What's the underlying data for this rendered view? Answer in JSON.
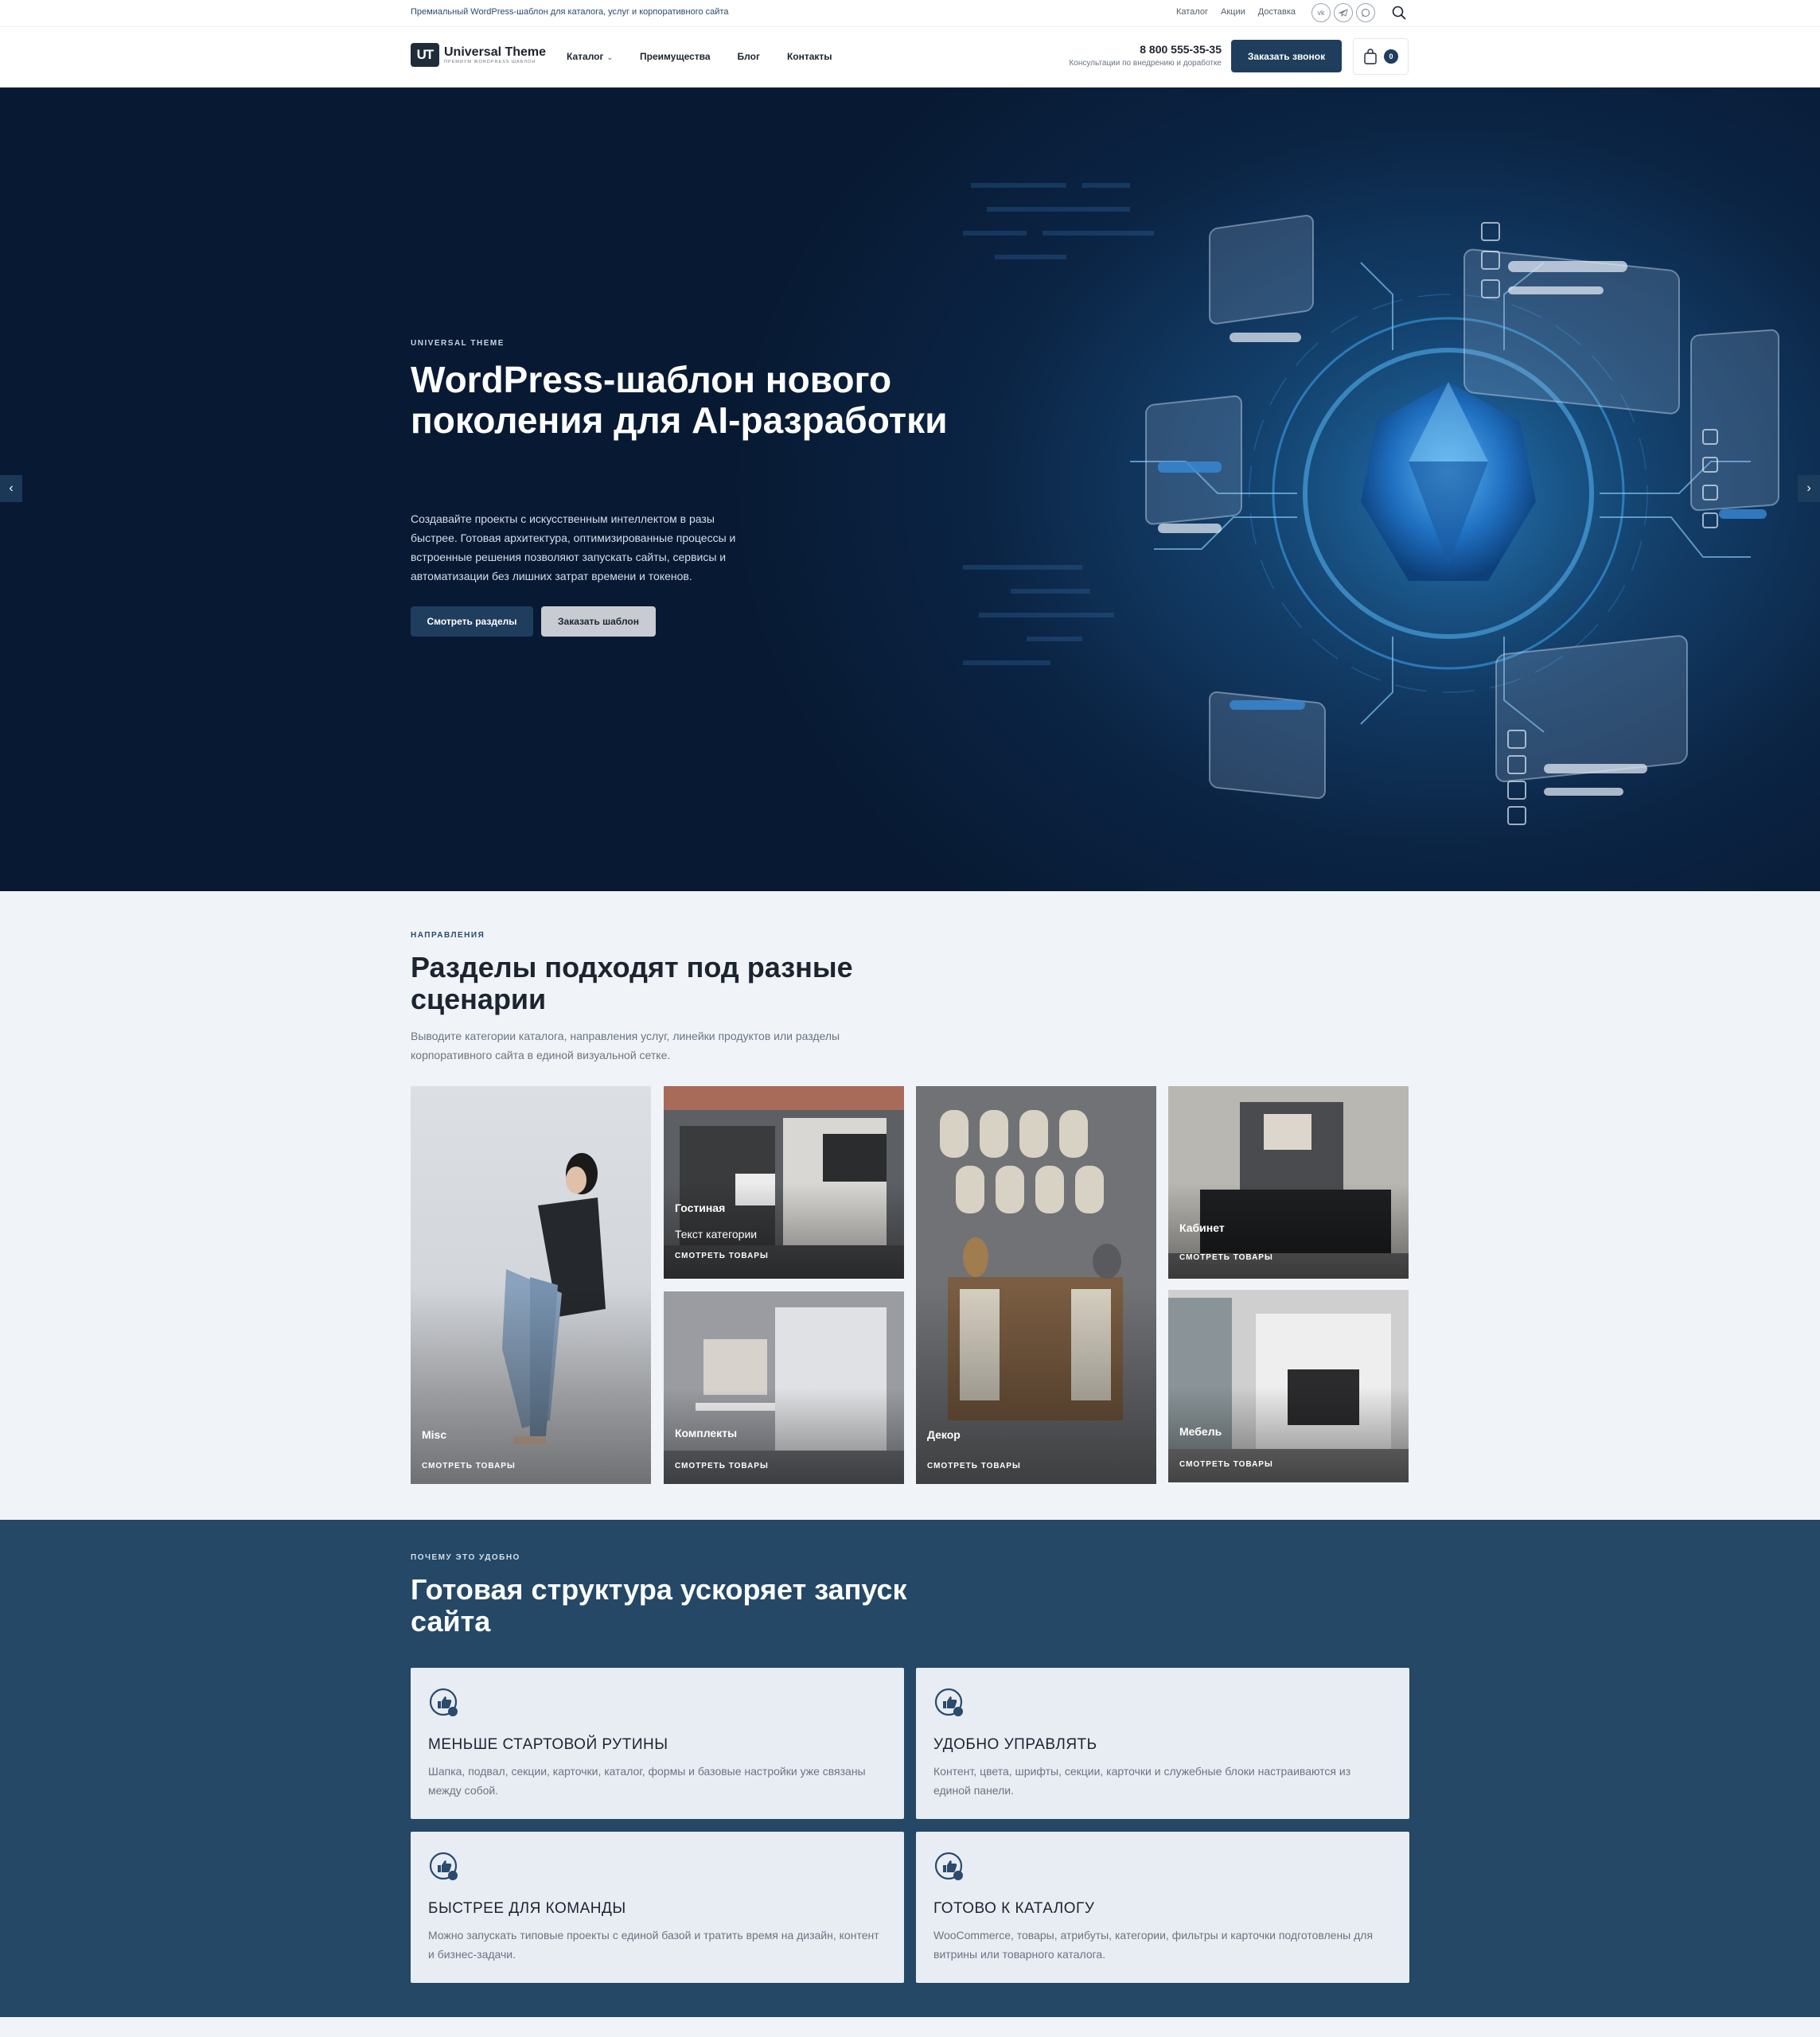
{
  "topbar": {
    "tagline": "Премиальный WordPress-шаблон для каталога, услуг и корпоративного сайта",
    "links": [
      "Каталог",
      "Акции",
      "Доставка"
    ],
    "socials": [
      "vk-icon",
      "telegram-icon",
      "whatsapp-icon"
    ]
  },
  "header": {
    "logo_mark": "UT",
    "logo_title": "Universal Theme",
    "logo_subtitle": "Премиум WordPress шаблон",
    "nav": [
      "Каталог",
      "Преимущества",
      "Блог",
      "Контакты"
    ],
    "phone": "8 800 555-35-35",
    "phone_sub": "Консультации по внедрению и доработке",
    "call_button": "Заказать звонок",
    "cart_count": "0"
  },
  "hero": {
    "eyebrow": "UNIVERSAL THEME",
    "title": "WordPress-шаблон нового поколения для AI-разработки",
    "description": "Создавайте проекты с искусственным интеллектом в разы быстрее. Готовая архитектура, оптимизированные процессы и встроенные решения позволяют запускать сайты, сервисы и автоматизации без лишних затрат времени и токенов.",
    "primary_button": "Смотреть разделы",
    "secondary_button": "Заказать шаблон",
    "colors": {
      "accent": "#1f3e5e",
      "hero_bg": "#0b2444"
    }
  },
  "sections": {
    "eyebrow": "НАПРАВЛЕНИЯ",
    "title": "Разделы подходят под разные сценарии",
    "description": "Выводите категории каталога, направления услуг, линейки продуктов или разделы корпоративного сайта в единой визуальной сетке.",
    "cards": [
      {
        "title": "Misc",
        "link": "СМОТРЕТЬ ТОВАРЫ"
      },
      {
        "title": "Гостиная",
        "text": "Текст категории",
        "link": "СМОТРЕТЬ ТОВАРЫ"
      },
      {
        "title": "Комплекты",
        "link": "СМОТРЕТЬ ТОВАРЫ"
      },
      {
        "title": "Декор",
        "link": "СМОТРЕТЬ ТОВАРЫ"
      },
      {
        "title": "Кабинет",
        "link": "СМОТРЕТЬ ТОВАРЫ"
      },
      {
        "title": "Мебель",
        "link": "СМОТРЕТЬ ТОВАРЫ"
      }
    ]
  },
  "features": {
    "eyebrow": "ПОЧЕМУ ЭТО УДОБНО",
    "title": "Готовая структура ускоряет запуск сайта",
    "items": [
      {
        "title": "МЕНЬШЕ СТАРТОВОЙ РУТИНЫ",
        "description": "Шапка, подвал, секции, карточки, каталог, формы и базовые настройки уже связаны между собой."
      },
      {
        "title": "УДОБНО УПРАВЛЯТЬ",
        "description": "Контент, цвета, шрифты, секции, карточки и служебные блоки настраиваются из единой панели."
      },
      {
        "title": "БЫСТРЕЕ ДЛЯ КОМАНДЫ",
        "description": "Можно запускать типовые проекты с единой базой и тратить время на дизайн, контент и бизнес-задачи."
      },
      {
        "title": "ГОТОВО К КАТАЛОГУ",
        "description": "WooCommerce, товары, атрибуты, категории, фильтры и карточки подготовлены для витрины или товарного каталога."
      }
    ]
  }
}
